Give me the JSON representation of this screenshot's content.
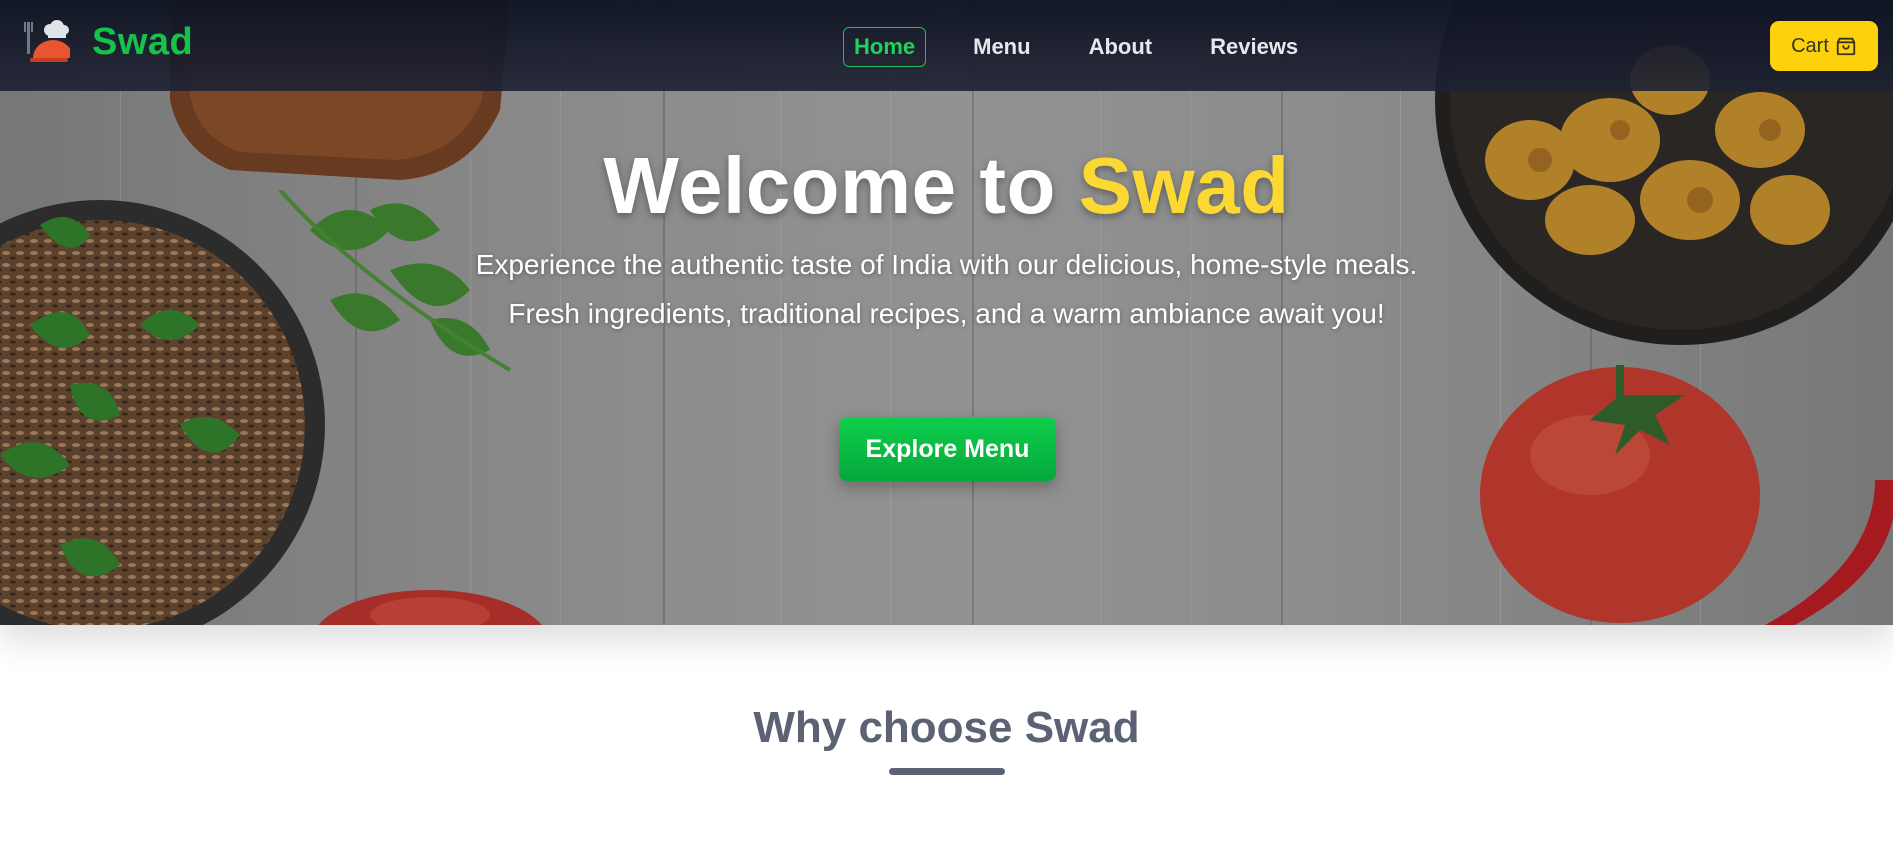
{
  "brand": {
    "name": "Swad",
    "color": "#16c24a"
  },
  "nav": {
    "links": [
      {
        "label": "Home",
        "active": true
      },
      {
        "label": "Menu",
        "active": false
      },
      {
        "label": "About",
        "active": false
      },
      {
        "label": "Reviews",
        "active": false
      }
    ]
  },
  "cart": {
    "label": "Cart",
    "icon": "shopping-bag-icon",
    "color": "#fdd20d"
  },
  "hero": {
    "title_prefix": "Welcome to ",
    "title_accent": "Swad",
    "accent_color": "#fcd932",
    "description": "Experience the authentic taste of India with our delicious, home-style meals. Fresh ingredients, traditional recipes, and a warm ambiance await you!",
    "cta_label": "Explore Menu",
    "cta_color": "#0fce4c"
  },
  "section": {
    "title": "Why choose Swad"
  }
}
